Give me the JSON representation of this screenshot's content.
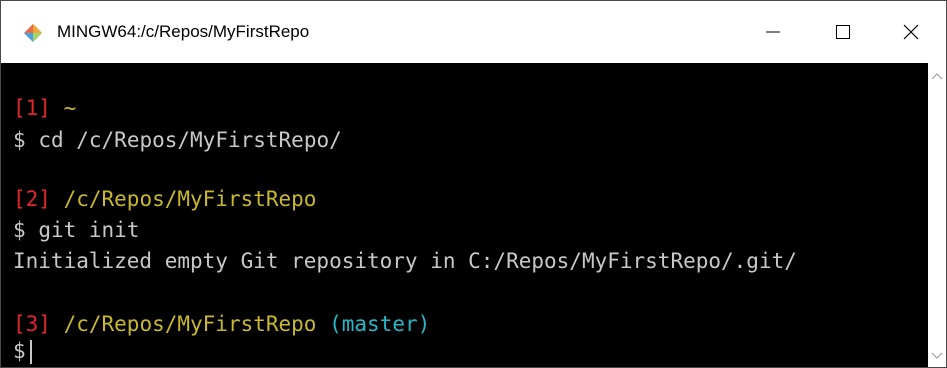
{
  "window": {
    "title": "MINGW64:/c/Repos/MyFirstRepo"
  },
  "controls": {
    "minimize": "—",
    "maximize": "☐",
    "close": "✕"
  },
  "terminal": {
    "block1": {
      "num": "[1]",
      "path": "~",
      "prompt": "$",
      "command": "cd /c/Repos/MyFirstRepo/"
    },
    "block2": {
      "num": "[2]",
      "path": "/c/Repos/MyFirstRepo",
      "prompt": "$",
      "command": "git init",
      "output": "Initialized empty Git repository in C:/Repos/MyFirstRepo/.git/"
    },
    "block3": {
      "num": "[3]",
      "path": "/c/Repos/MyFirstRepo",
      "branch": "(master)",
      "prompt": "$"
    }
  },
  "colors": {
    "prompt_number": "#e2262e",
    "path": "#c8b82c",
    "branch": "#27b8c8",
    "text": "#c8c8c8",
    "background": "#000000"
  }
}
